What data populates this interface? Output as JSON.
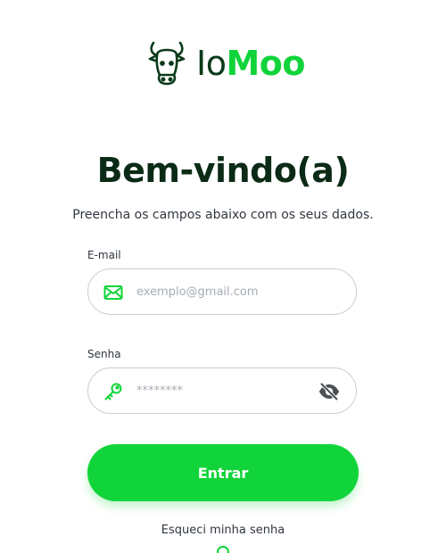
{
  "brand": {
    "logo_prefix": "Io",
    "logo_suffix": "Moo",
    "logo_icon": "bull-head-icon",
    "colors": {
      "primary": "#11d43a",
      "dark": "#0b2b16"
    }
  },
  "header": {
    "title": "Bem-vindo(a)",
    "subtitle": "Preencha os campos abaixo com os seus dados."
  },
  "form": {
    "email": {
      "label": "E-mail",
      "placeholder": "exemplo@gmail.com",
      "icon": "envelope-icon"
    },
    "password": {
      "label": "Senha",
      "placeholder": "********",
      "icon": "key-icon",
      "toggle_icon": "eye-off-icon"
    },
    "submit_label": "Entrar"
  },
  "links": {
    "forgot_password": "Esqueci minha senha"
  }
}
